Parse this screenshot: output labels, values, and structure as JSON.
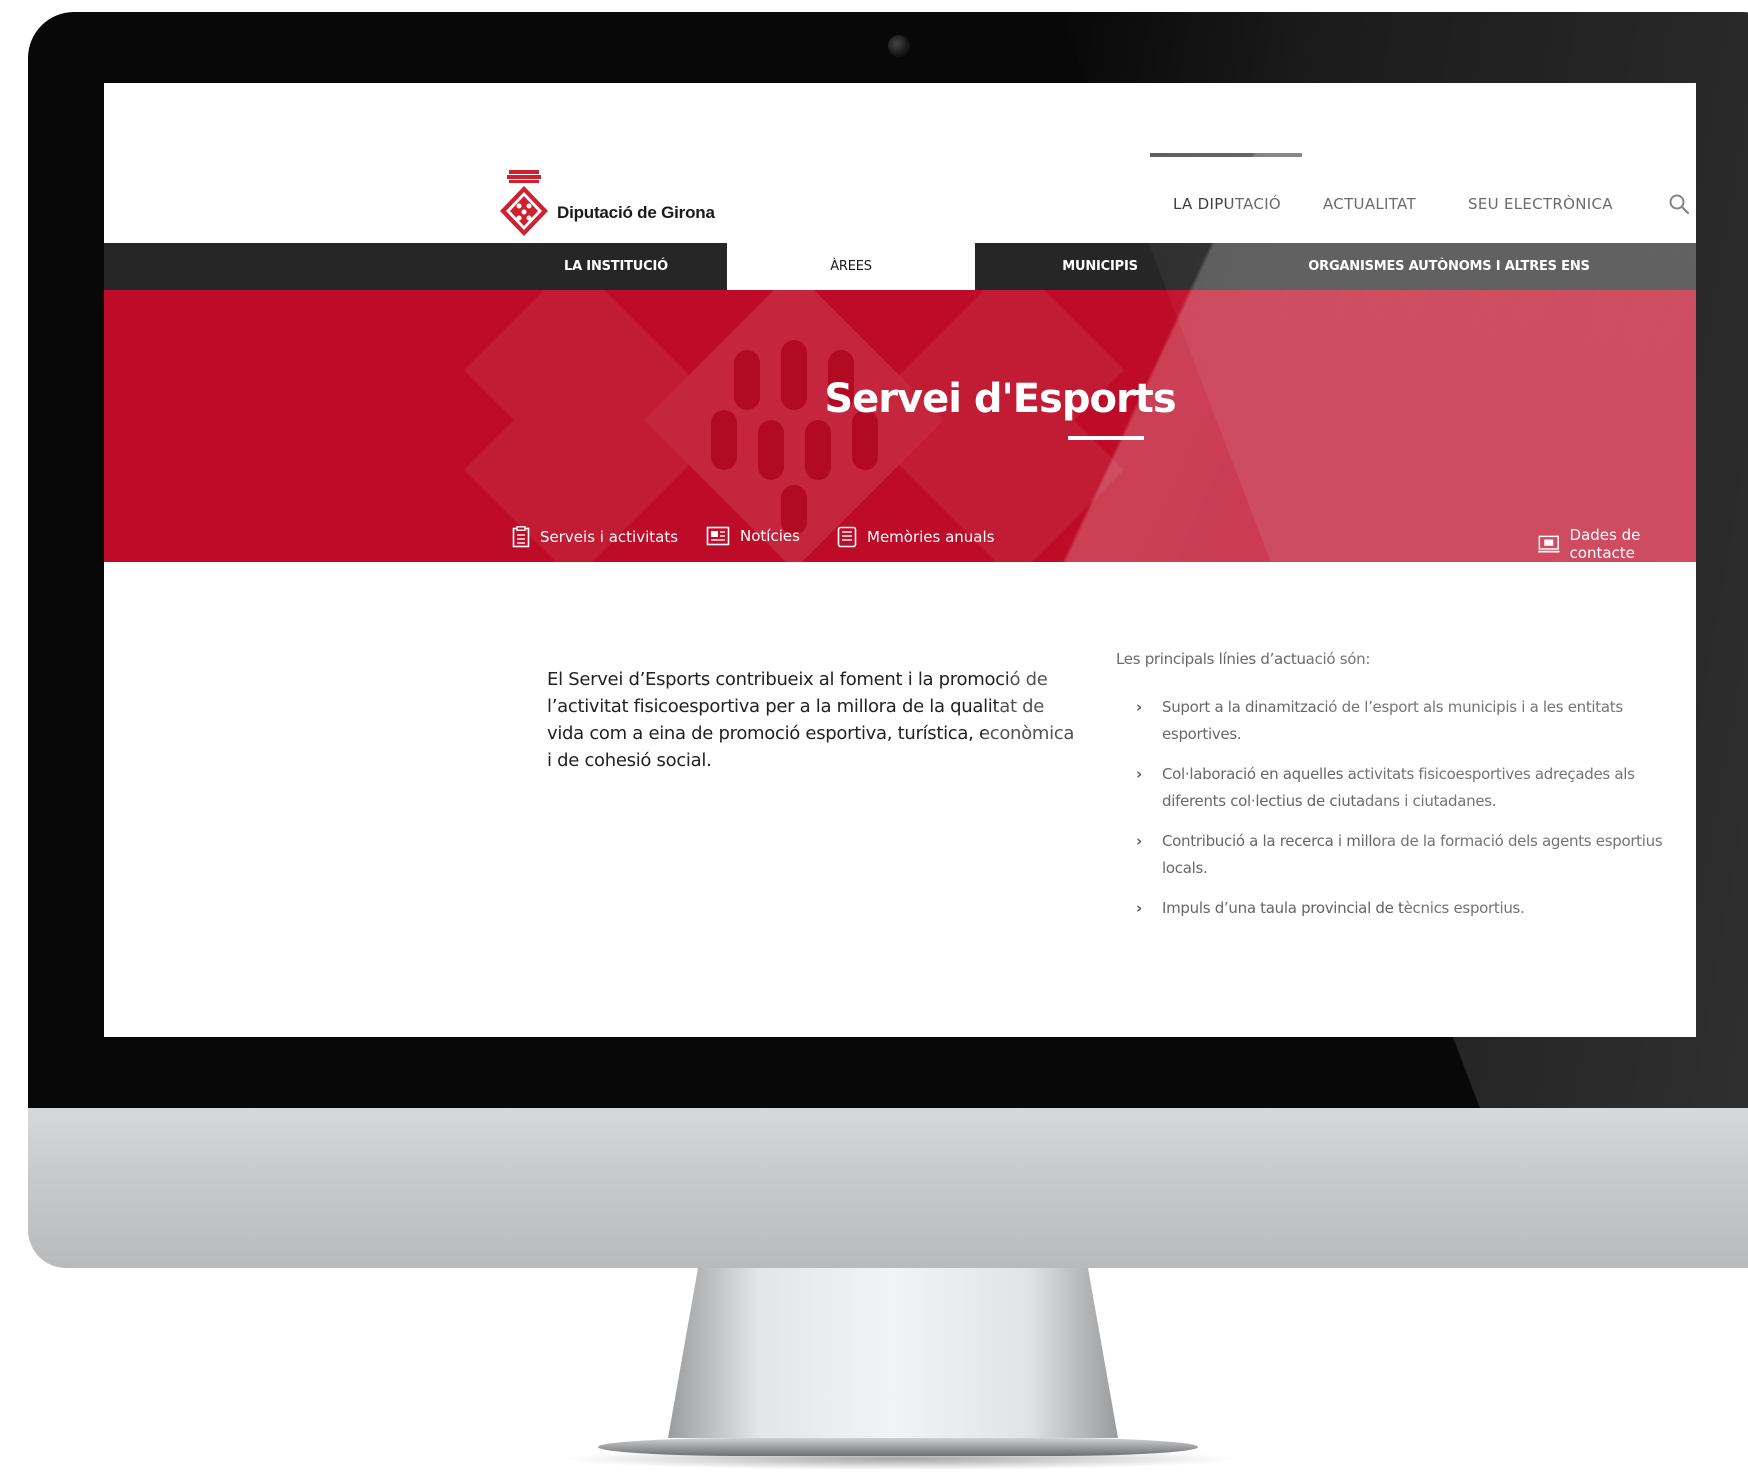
{
  "site": {
    "logo_text": "Diputació de Girona"
  },
  "top_nav": {
    "items": [
      {
        "label": "LA DIPUTACIÓ"
      },
      {
        "label": "ACTUALITAT"
      },
      {
        "label": "SEU ELECTRÒNICA"
      }
    ]
  },
  "main_nav": {
    "tabs": [
      {
        "label": "LA INSTITUCIÓ",
        "active": false
      },
      {
        "label": "ÀREES",
        "active": true
      },
      {
        "label": "MUNICIPIS",
        "active": false
      },
      {
        "label": "ORGANISMES AUTÒNOMS I ALTRES ENS",
        "active": false
      }
    ]
  },
  "hero": {
    "title": "Servei d'Esports",
    "links": [
      {
        "label": "Serveis i activitats",
        "icon": "clipboard-icon"
      },
      {
        "label": "Notícies",
        "icon": "newspaper-icon"
      },
      {
        "label": "Memòries anuals",
        "icon": "document-icon"
      },
      {
        "label": "Dades de contacte",
        "icon": "contact-card-icon"
      }
    ]
  },
  "content": {
    "intro": "El Servei d’Esports contribueix al foment i la promoció de l’activitat fisicoesportiva per a la millora de la qualitat de vida com a eina de promoció esportiva, turística, econòmica i de cohesió social.",
    "lines_title": "Les principals línies d’actuació són:",
    "lines": [
      "Suport a la dinamització de l’esport als municipis i a les entitats esportives.",
      "Col·laboració en aquelles activitats fisicoesportives adreçades als diferents col·lectius de ciutadans i ciutadanes.",
      "Contribució a la recerca i millora de la formació dels agents esportius locals.",
      "Impuls d’una taula provincial de tècnics esportius."
    ]
  },
  "colors": {
    "brand_red": "#be0b27",
    "nav_dark": "#262626"
  }
}
